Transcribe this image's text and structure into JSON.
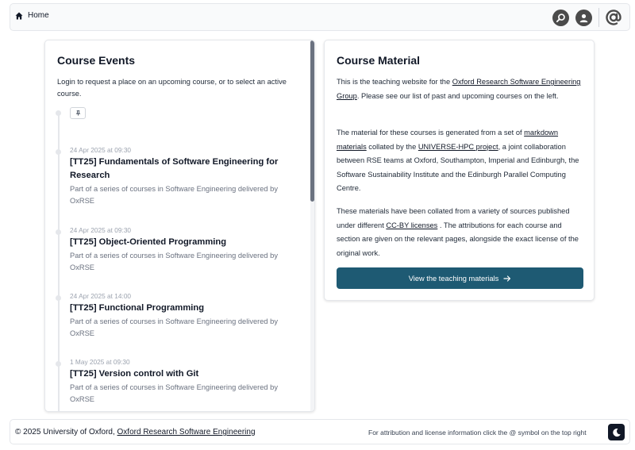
{
  "nav": {
    "home_label": "Home",
    "icons": [
      "home-icon",
      "search-icon",
      "user-icon",
      "at-symbol-icon"
    ]
  },
  "events": {
    "heading": "Course Events",
    "intro": "Login to request a place on an upcoming course, or to select an active course.",
    "items": [
      {
        "date": "24 Apr 2025 at 09:30",
        "title": "[TT25] Fundamentals of Software Engineering for Research",
        "description": "Part of a series of courses in Software Engineering delivered by OxRSE"
      },
      {
        "date": "24 Apr 2025 at 09:30",
        "title": "[TT25] Object-Oriented Programming",
        "description": "Part of a series of courses in Software Engineering delivered by OxRSE"
      },
      {
        "date": "24 Apr 2025 at 14:00",
        "title": "[TT25] Functional Programming",
        "description": "Part of a series of courses in Software Engineering delivered by OxRSE"
      },
      {
        "date": "1 May 2025 at 09:30",
        "title": "[TT25] Version control with Git",
        "description": "Part of a series of courses in Software Engineering delivered by OxRSE"
      }
    ]
  },
  "material": {
    "heading": "Course Material",
    "p1": {
      "before": "This is the teaching website for the ",
      "link": "Oxford Research Software Engineering Group",
      "after": ". Please see our list of past and upcoming courses on the left."
    },
    "p2": {
      "before": "The material for these courses is generated from a set of ",
      "link1": "markdown materials",
      "middle": " collated by the ",
      "link2": "UNIVERSE-HPC project",
      "after": ", a joint collaboration between RSE teams at Oxford, Southampton, Imperial and Edinburgh, the Software Sustainability Institute and the Edinburgh Parallel Computing Centre."
    },
    "p3": {
      "before": "These materials have been collated from a variety of sources published under different ",
      "link": "CC-BY licenses",
      "after": " . The attributions for each course and section are given on the relevant pages, alongside the exact license of the original work."
    },
    "button_label": "View the teaching materials",
    "button_color": "#1e5a73"
  },
  "footer": {
    "copyright": "© 2025 University of Oxford, ",
    "org_link": "Oxford Research Software Engineering",
    "attribution": "For attribution and license information click the @ symbol on the top right"
  }
}
